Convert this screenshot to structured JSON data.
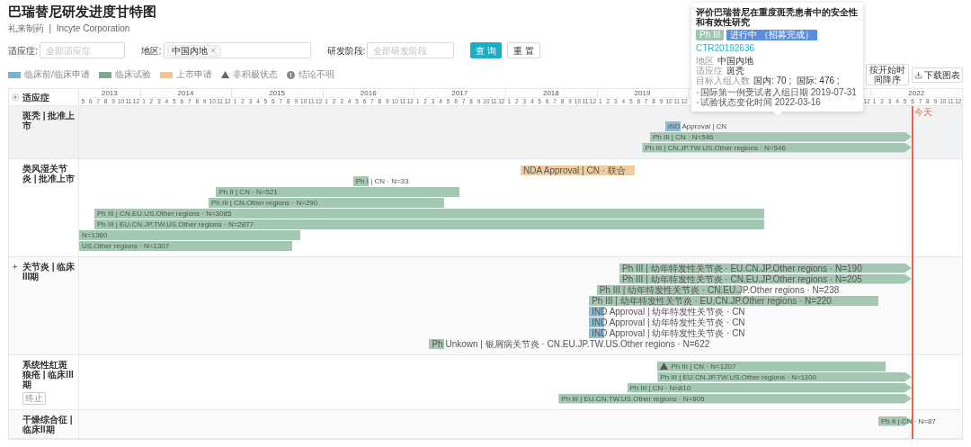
{
  "title": "巴瑞替尼研发进度甘特图",
  "subtitle": "礼来制药  |  Incyte Corporation",
  "filters": [
    {
      "kind": "select",
      "label": "适应症:",
      "placeholder": "全部适应症"
    },
    {
      "kind": "tags",
      "label": "地区:",
      "tags": [
        "中国内地"
      ]
    },
    {
      "kind": "select",
      "label": "研发阶段:",
      "placeholder": "全部研发阶段"
    }
  ],
  "actions": [
    {
      "kind": "primary",
      "label": "查 询"
    },
    {
      "kind": "default",
      "label": "重 置"
    }
  ],
  "legend": [
    {
      "kind": "swatch",
      "label": "临床前/临床申请",
      "color": "#7eb0cc"
    },
    {
      "kind": "swatch",
      "label": "临床试验",
      "color": "#7fa88f"
    },
    {
      "kind": "swatch",
      "label": "上市申请",
      "color": "#edc896"
    },
    {
      "kind": "triangle",
      "label": "非积极状态"
    },
    {
      "kind": "info",
      "label": "结论不明"
    }
  ],
  "toolbar": [
    {
      "kind": "plain",
      "label": "按开始时间降序"
    },
    {
      "kind": "download",
      "label": "下载图表"
    }
  ],
  "gantt": {
    "header": "适应症",
    "years": [
      {
        "year": "2013",
        "months": [
          "5",
          "6",
          "7",
          "8",
          "9",
          "10",
          "11",
          "12"
        ]
      },
      {
        "year": "2014",
        "months": [
          "1",
          "2",
          "3",
          "4",
          "5",
          "6",
          "7",
          "8",
          "9",
          "10",
          "11",
          "12"
        ]
      },
      {
        "year": "2015",
        "months": [
          "1",
          "2",
          "3",
          "4",
          "5",
          "6",
          "7",
          "8",
          "9",
          "10",
          "11",
          "12"
        ]
      },
      {
        "year": "2016",
        "months": [
          "1",
          "2",
          "3",
          "4",
          "5",
          "6",
          "7",
          "8",
          "9",
          "10",
          "11",
          "12"
        ]
      },
      {
        "year": "2017",
        "months": [
          "1",
          "2",
          "3",
          "4",
          "5",
          "6",
          "7",
          "8",
          "9",
          "10",
          "11",
          "12"
        ]
      },
      {
        "year": "2018",
        "months": [
          "1",
          "2",
          "3",
          "4",
          "5",
          "6",
          "7",
          "8",
          "9",
          "10",
          "11",
          "12"
        ]
      },
      {
        "year": "2019",
        "months": [
          "1",
          "2",
          "3",
          "4",
          "5",
          "6",
          "7",
          "8",
          "9",
          "10",
          "11",
          "12"
        ]
      },
      {
        "months": [
          "12"
        ]
      },
      {
        "year": "2022",
        "months": [
          "1",
          "2",
          "3",
          "4",
          "5",
          "6",
          "7",
          "8",
          "9",
          "10",
          "11",
          "12"
        ]
      }
    ],
    "today": {
      "label": "今天"
    },
    "rows": [
      {
        "label": "斑秃 | 批准上市",
        "highlighted": true,
        "expandable": false,
        "bars": [
          {
            "kind": "ind",
            "label": "IND Approval | CN",
            "ongoing": false,
            "inactive": false
          },
          {
            "kind": "trial",
            "label": "Ph III | CN · N=546",
            "ongoing": true,
            "inactive": false
          },
          {
            "kind": "trial",
            "label": "Ph III | CN.JP.TW.US.Other regions · N=546",
            "ongoing": true,
            "inactive": false
          }
        ]
      },
      {
        "label": "类风湿关节炎 | 批准上市",
        "highlighted": false,
        "expandable": false,
        "bars": [
          {
            "kind": "nda",
            "label": "NDA Approval | CN · 联合",
            "ongoing": false,
            "inactive": false
          },
          {
            "kind": "trial",
            "label": "Ph I | CN · N=33",
            "ongoing": false,
            "inactive": false
          },
          {
            "kind": "trial",
            "label": "Ph II | CN · N=521",
            "ongoing": false,
            "inactive": false
          },
          {
            "kind": "trial",
            "label": "Ph III | CN.Other regions · N=290",
            "ongoing": false,
            "inactive": false
          },
          {
            "kind": "trial",
            "label": "Ph III | CN.EU.US.Other regions · N=3085",
            "ongoing": false,
            "inactive": false
          },
          {
            "kind": "trial",
            "label": "Ph III | EU.CN.JP.TW.US.Other regions · N=2877",
            "ongoing": false,
            "inactive": false
          },
          {
            "kind": "trial",
            "label": "N=1360",
            "ongoing": false,
            "inactive": false
          },
          {
            "kind": "trial",
            "label": "US.Other regions · N=1307",
            "ongoing": false,
            "inactive": false
          }
        ]
      },
      {
        "label": "关节炎 | 临床III期",
        "highlighted": false,
        "expandable": true,
        "bars": [
          {
            "kind": "trial",
            "label": "Ph III | 幼年特发性关节炎 · EU.CN.JP.Other regions · N=190",
            "ongoing": true,
            "inactive": false
          },
          {
            "kind": "trial",
            "label": "Ph III | 幼年特发性关节炎 · CN.EU.JP.Other regions · N=205",
            "ongoing": true,
            "inactive": false
          },
          {
            "kind": "trial",
            "label": "Ph III | 幼年特发性关节炎 · CN.EU.JP.Other regions · N=238",
            "ongoing": false,
            "inactive": false
          },
          {
            "kind": "trial",
            "label": "Ph III | 幼年特发性关节炎 · EU.CN.JP.Other regions · N=220",
            "ongoing": false,
            "inactive": false
          },
          {
            "kind": "ind",
            "label": "IND Approval | 幼年特发性关节炎 · CN",
            "ongoing": false,
            "inactive": false
          },
          {
            "kind": "ind",
            "label": "IND Approval | 幼年特发性关节炎 · CN",
            "ongoing": false,
            "inactive": false
          },
          {
            "kind": "ind",
            "label": "IND Approval | 幼年特发性关节炎 · CN",
            "ongoing": false,
            "inactive": false
          },
          {
            "kind": "trial",
            "label": "Ph Unkown | 银屑病关节炎 · CN.EU.JP.TW.US.Other regions · N=622",
            "ongoing": false,
            "inactive": false
          }
        ]
      },
      {
        "label": "系统性红斑狼疮 | 临床III期",
        "tag": "终止",
        "highlighted": false,
        "expandable": false,
        "bars": [
          {
            "kind": "trial",
            "label": "Ph III | CN · N=1207",
            "ongoing": false,
            "inactive": true
          },
          {
            "kind": "trial",
            "label": "Ph III | EU.CN.JP.TW.US.Other regions · N=1100",
            "ongoing": true,
            "inactive": false
          },
          {
            "kind": "trial",
            "label": "Ph III | CN · N=810",
            "ongoing": true,
            "inactive": false
          },
          {
            "kind": "trial",
            "label": "Ph III | EU.CN.TW.US.Other regions · N=809",
            "ongoing": true,
            "inactive": false
          }
        ]
      },
      {
        "label": "干燥综合征 | 临床II期",
        "highlighted": false,
        "expandable": false,
        "bars": [
          {
            "kind": "trial",
            "label": "Ph II | CN · N=87",
            "ongoing": true,
            "inactive": false
          }
        ]
      }
    ]
  },
  "tooltip": {
    "title": "评价巴瑞替尼在重度斑秃患者中的安全性和有效性研究",
    "tags": [
      {
        "text": "Ph III",
        "color": "#9cc5ae"
      },
      {
        "text": "进行中 （招募完成）",
        "color": "#5b8ede"
      }
    ],
    "link": "CTR20192636",
    "fields": [
      {
        "label": "地区",
        "value": "中国内地"
      },
      {
        "label": "适应症",
        "value": "斑秃"
      },
      {
        "label": "目标入组人数",
        "value": "国内: 70 ;  国际: 476 ;"
      }
    ],
    "timeline": [
      "国际第一例受试者入组日期 2019-07-31",
      "试验状态变化时间 2022-03-16"
    ]
  }
}
